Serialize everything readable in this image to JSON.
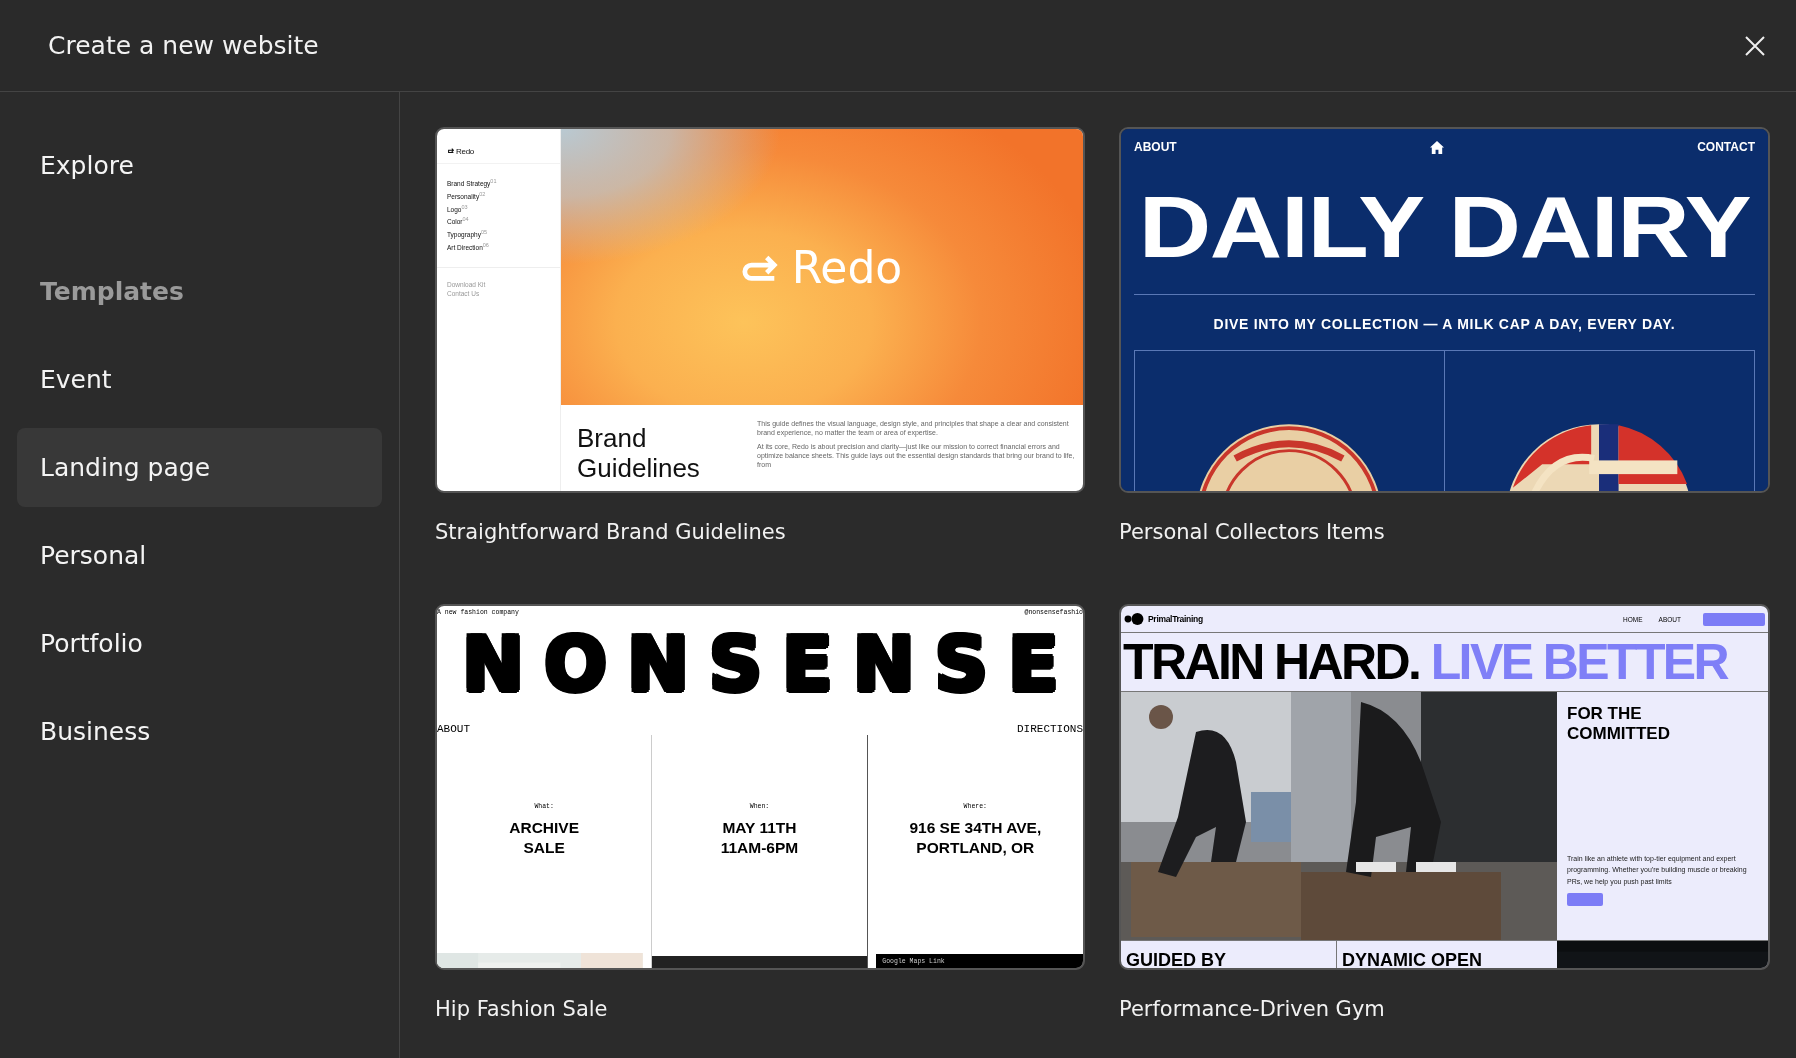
{
  "window": {
    "title": "Create a new website"
  },
  "sidebar": {
    "items": [
      {
        "label": "Explore",
        "kind": "link",
        "selected": false
      },
      {
        "label": "Templates",
        "kind": "heading",
        "selected": false
      },
      {
        "label": "Event",
        "kind": "link",
        "selected": false
      },
      {
        "label": "Landing page",
        "kind": "link",
        "selected": true
      },
      {
        "label": "Personal",
        "kind": "link",
        "selected": false
      },
      {
        "label": "Portfolio",
        "kind": "link",
        "selected": false
      },
      {
        "label": "Business",
        "kind": "link",
        "selected": false
      }
    ]
  },
  "templates": [
    {
      "name": "Straightforward Brand Guidelines",
      "preview": {
        "kind": "brand-guide",
        "logo": "Redo",
        "nav": [
          "Brand Strategy$^{01}$",
          "Personality$^{02}$",
          "Logo$^{03}$",
          "Color$^{04}$",
          "Typography$^{05}$",
          "Art Direction$^{06}$"
        ],
        "links": [
          "Download Kit",
          "Contact Us"
        ],
        "hero": "Redo",
        "heading": "Brand\nGuidelines",
        "paragraphs": [
          "This guide defines the visual language, design style, and principles that shape a clear and consistent brand experience, no matter the team or area of expertise.",
          "At its core, Redo is about precision and clarity—just like our mission to correct financial errors and optimize balance sheets. This guide lays out the essential design standards that bring our brand to life, from"
        ]
      }
    },
    {
      "name": "Personal Collectors Items",
      "preview": {
        "kind": "collection",
        "nav_left": "ABOUT",
        "nav_right": "CONTACT",
        "title": "DAILY DAIRY",
        "tagline": "DIVE INTO MY COLLECTION — A MILK CAP A DAY, EVERY DAY."
      }
    },
    {
      "name": "Hip Fashion Sale",
      "preview": {
        "kind": "event",
        "tagline": "A new fashion company",
        "handle": "@nonsensefashio",
        "title": "NONSENSE",
        "nav_left": "ABOUT",
        "nav_right": "DIRECTIONS",
        "columns": [
          {
            "label": "What:",
            "value": "ARCHIVE\nSALE"
          },
          {
            "label": "When:",
            "value": "MAY 11TH\n11AM-6PM"
          },
          {
            "label": "Where:",
            "value": "916 SE 34TH AVE,\nPORTLAND, OR"
          }
        ],
        "map_link": "Google Maps Link"
      }
    },
    {
      "name": "Performance-Driven Gym",
      "preview": {
        "kind": "gym",
        "brand": "PrimalTraining",
        "nav": [
          "HOME",
          "ABOUT"
        ],
        "headline": "TRAIN HARD.",
        "headline_accent": "LIVE BETTER",
        "side_title": "FOR THE\nCOMMITTED",
        "body": "Train like an athlete with top-tier equipment and expert programming. Whether you're building muscle or breaking PRs, we help you push past limits",
        "bottom": [
          "GUIDED BY",
          "DYNAMIC OPEN"
        ]
      }
    }
  ]
}
